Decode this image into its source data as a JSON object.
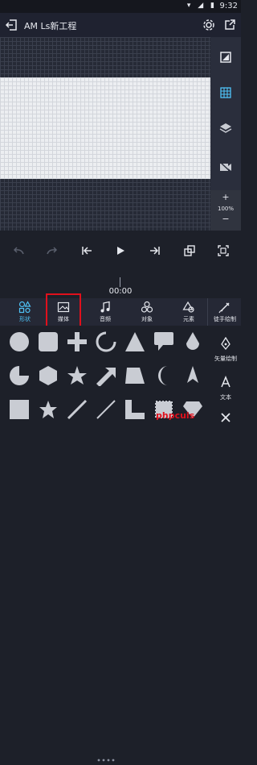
{
  "status_bar": {
    "time": "9:32"
  },
  "app_bar": {
    "title": "AM Ls新工程"
  },
  "zoom": {
    "plus": "+",
    "level": "100%",
    "minus": "−"
  },
  "playback": {
    "timecode": "00:00"
  },
  "categories": [
    {
      "id": "shape",
      "label": "形状",
      "active": true
    },
    {
      "id": "media",
      "label": "媒体",
      "active": false
    },
    {
      "id": "audio",
      "label": "音频",
      "active": false
    },
    {
      "id": "object",
      "label": "对象",
      "active": false
    },
    {
      "id": "element",
      "label": "元素",
      "active": false
    }
  ],
  "freehand": {
    "label": "徒手绘制"
  },
  "right_actions": {
    "vector": "矢量绘制",
    "text": "文本"
  },
  "watermark": "phpcuis",
  "colors": {
    "accent": "#4fc3f7",
    "highlight": "#e0101c",
    "shape": "#c9ccd3"
  }
}
